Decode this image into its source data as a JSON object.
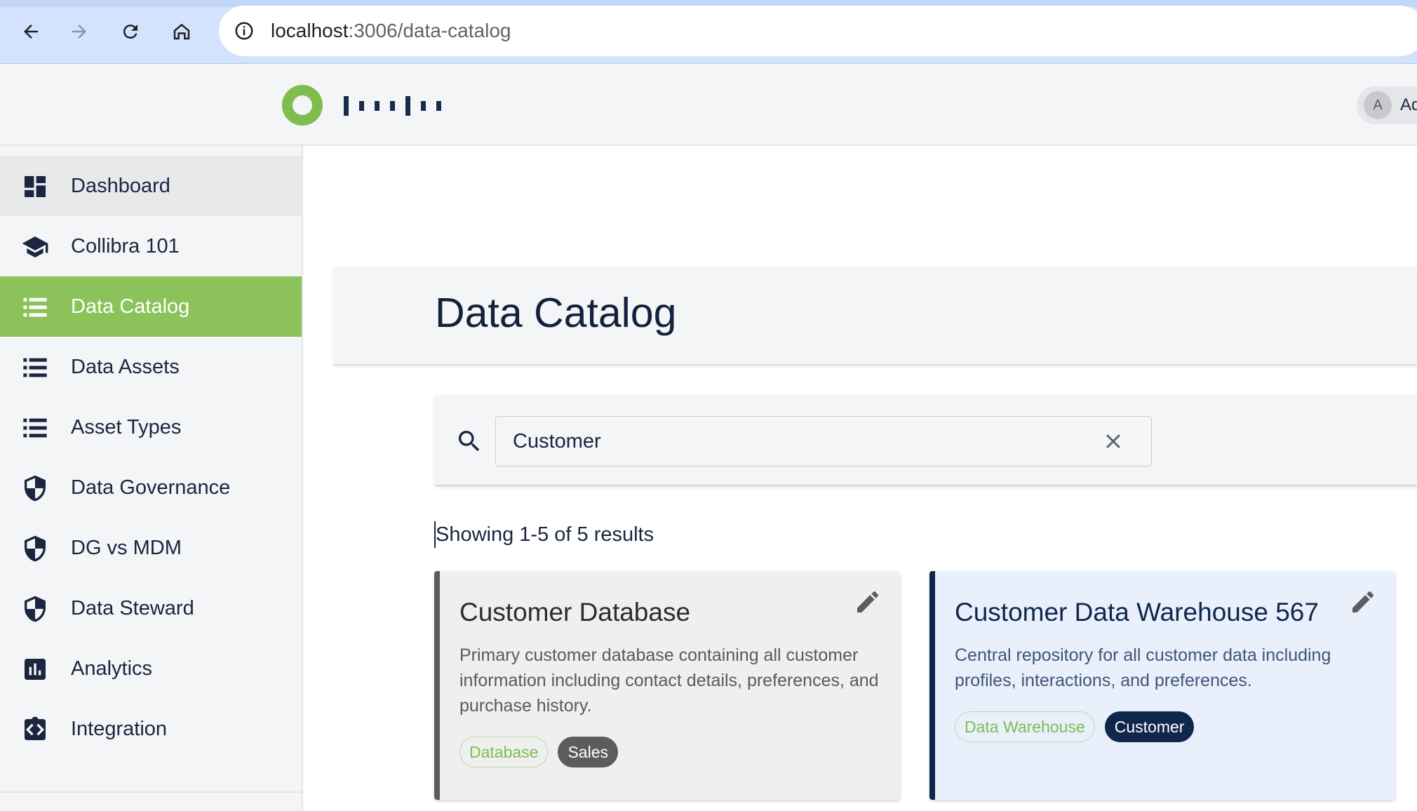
{
  "browser": {
    "url_host": "localhost",
    "url_path": ":3006/data-catalog"
  },
  "header": {
    "user_initial": "A",
    "user_name": "Ad"
  },
  "sidebar": {
    "items": [
      {
        "label": "Dashboard",
        "icon": "dashboard-icon"
      },
      {
        "label": "Collibra 101",
        "icon": "school-icon"
      },
      {
        "label": "Data Catalog",
        "icon": "list-icon"
      },
      {
        "label": "Data Assets",
        "icon": "list-icon"
      },
      {
        "label": "Asset Types",
        "icon": "list-icon"
      },
      {
        "label": "Data Governance",
        "icon": "shield-icon"
      },
      {
        "label": "DG vs MDM",
        "icon": "shield-icon"
      },
      {
        "label": "Data Steward",
        "icon": "shield-icon"
      },
      {
        "label": "Analytics",
        "icon": "analytics-icon"
      },
      {
        "label": "Integration",
        "icon": "integration-icon"
      }
    ]
  },
  "main": {
    "title": "Data Catalog",
    "search": {
      "value": "Customer",
      "placeholder": ""
    },
    "results_text": "Showing 1-5 of 5 results",
    "cards": [
      {
        "title": "Customer Database",
        "description": "Primary customer database containing all customer information including contact details, preferences, and purchase history.",
        "tags": [
          "Database",
          "Sales"
        ]
      },
      {
        "title": "Customer Data Warehouse 567",
        "description": "Central repository for all customer data including profiles, interactions, and preferences.",
        "tags": [
          "Data Warehouse",
          "Customer"
        ]
      }
    ]
  },
  "colors": {
    "accent_green": "#8bc25a",
    "navy": "#10264d",
    "browser_chrome": "#d3e3fd"
  }
}
